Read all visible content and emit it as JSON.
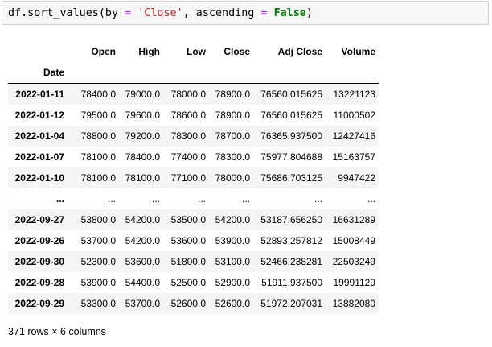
{
  "code_cell": {
    "prefix": "df.sort_values(by ",
    "op1": "=",
    "mid1": " ",
    "str1": "'Close'",
    "mid2": ", ascending ",
    "op2": "=",
    "mid3": " ",
    "kw1": "False",
    "suffix": ")"
  },
  "table": {
    "columns": [
      "Open",
      "High",
      "Low",
      "Close",
      "Adj Close",
      "Volume"
    ],
    "index_name": "Date",
    "rows": [
      {
        "date": "2022-01-11",
        "cells": [
          "78400.0",
          "79000.0",
          "78000.0",
          "78900.0",
          "76560.015625",
          "13221123"
        ]
      },
      {
        "date": "2022-01-12",
        "cells": [
          "79500.0",
          "79600.0",
          "78600.0",
          "78900.0",
          "76560.015625",
          "11000502"
        ]
      },
      {
        "date": "2022-01-04",
        "cells": [
          "78800.0",
          "79200.0",
          "78300.0",
          "78700.0",
          "76365.937500",
          "12427416"
        ]
      },
      {
        "date": "2022-01-07",
        "cells": [
          "78100.0",
          "78400.0",
          "77400.0",
          "78300.0",
          "75977.804688",
          "15163757"
        ]
      },
      {
        "date": "2022-01-10",
        "cells": [
          "78100.0",
          "78100.0",
          "77100.0",
          "78000.0",
          "75686.703125",
          "9947422"
        ]
      },
      {
        "date": "...",
        "cells": [
          "...",
          "...",
          "...",
          "...",
          "...",
          "..."
        ]
      },
      {
        "date": "2022-09-27",
        "cells": [
          "53800.0",
          "54200.0",
          "53500.0",
          "54200.0",
          "53187.656250",
          "16631289"
        ]
      },
      {
        "date": "2022-09-26",
        "cells": [
          "53700.0",
          "54200.0",
          "53600.0",
          "53900.0",
          "52893.257812",
          "15008449"
        ]
      },
      {
        "date": "2022-09-30",
        "cells": [
          "52300.0",
          "53600.0",
          "51800.0",
          "53100.0",
          "52466.238281",
          "22503249"
        ]
      },
      {
        "date": "2022-09-28",
        "cells": [
          "53900.0",
          "54400.0",
          "52500.0",
          "52900.0",
          "51911.937500",
          "19991129"
        ]
      },
      {
        "date": "2022-09-29",
        "cells": [
          "53300.0",
          "53700.0",
          "52600.0",
          "52600.0",
          "51972.207031",
          "13882080"
        ]
      }
    ]
  },
  "footer": {
    "shape_text": "371 rows × 6 columns"
  }
}
